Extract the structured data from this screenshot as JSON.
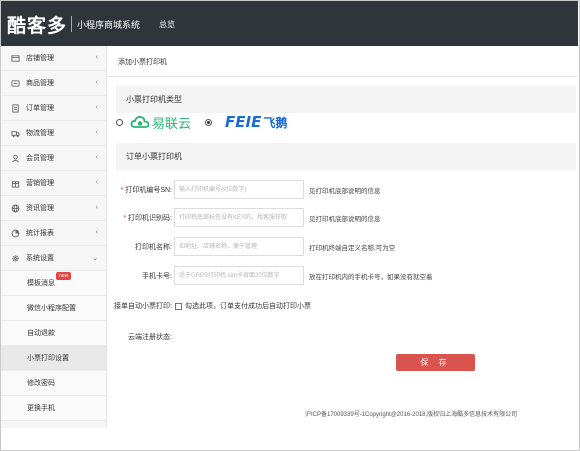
{
  "header": {
    "logo": "酷客多",
    "subtitle": "小程序商城系统",
    "nav_overview": "总览"
  },
  "sidebar": {
    "items": [
      {
        "label": "店铺管理",
        "icon": "store-icon",
        "chevron": "‹"
      },
      {
        "label": "商品管理",
        "icon": "product-icon",
        "chevron": "‹"
      },
      {
        "label": "订单管理",
        "icon": "order-icon",
        "chevron": "‹"
      },
      {
        "label": "物流管理",
        "icon": "truck-icon",
        "chevron": "‹"
      },
      {
        "label": "会员管理",
        "icon": "user-icon",
        "chevron": "‹"
      },
      {
        "label": "营销管理",
        "icon": "marketing-icon",
        "chevron": "‹"
      },
      {
        "label": "资讯管理",
        "icon": "globe-icon",
        "chevron": "‹"
      },
      {
        "label": "统计报表",
        "icon": "pie-chart-icon",
        "chevron": "‹"
      },
      {
        "label": "系统设置",
        "icon": "gear-icon",
        "chevron": "⌄"
      }
    ],
    "subitems": [
      {
        "label": "模板消息",
        "badge": "new"
      },
      {
        "label": "微信小程序配置"
      },
      {
        "label": "自动退款"
      },
      {
        "label": "小票打印设置"
      },
      {
        "label": "修改密码"
      },
      {
        "label": "更换手机"
      }
    ]
  },
  "main": {
    "breadcrumb": "添加小票打印机",
    "type_section_title": "小票打印机类型",
    "printers": {
      "yilianyun": "易联云",
      "feie_a": "FEIE",
      "feie_b": "飞鹅"
    },
    "order_section_title": "订单小票打印机",
    "form": {
      "sn": {
        "label": "打印机编号SN:",
        "placeholder": "输入打印机编号(9位数字)",
        "help": "见打印机底部说明的信息"
      },
      "key": {
        "label": "打印机识别码:",
        "placeholder": "打印机底部标签没有KEY的，找客服获取",
        "help": "见打印机底部说明的信息"
      },
      "name": {
        "label": "打印机名称:",
        "placeholder": "如地址、店铺名称、便于管理",
        "help": "打印机终端自定义名称,可为空"
      },
      "card": {
        "label": "手机卡号:",
        "placeholder": "适于GRPS打印机,sim卡背面20位数字",
        "help": "放在打印机内的手机卡号，如果没有就空着"
      }
    },
    "auto_print": {
      "label": "接单自动小票打印:",
      "text": "勾选此项，订单支付成功后自动打印小票"
    },
    "register_status": "云端注册状态:",
    "save_label": "保 存",
    "footer": "沪ICP备17009339号-1Copyright@2016-2018,版权归上海酷多信息技术有限公司"
  },
  "colors": {
    "header_bg": "#2f353b",
    "save_button": "#d9534f",
    "yilianyun_green": "#2bb673",
    "feie_blue": "#1a6bd8",
    "required_mark": "#e33333"
  }
}
